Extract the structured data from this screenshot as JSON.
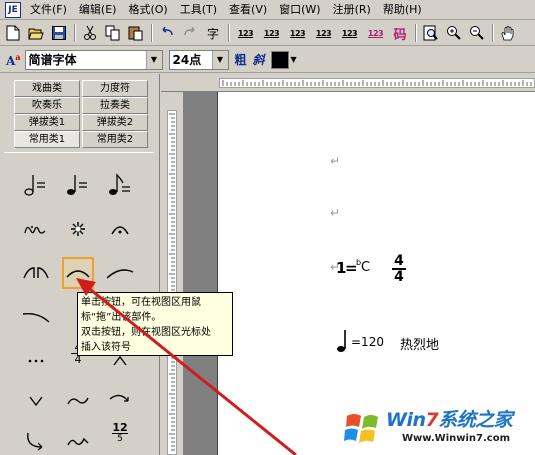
{
  "app": {
    "logo_text": "JE"
  },
  "menu": [
    "文件(F)",
    "编辑(E)",
    "格式(O)",
    "工具(T)",
    "查看(V)",
    "窗口(W)",
    "注册(R)",
    "帮助(H)"
  ],
  "toolbar": {
    "char_button": "字",
    "num_buttons": [
      "123",
      "123",
      "123",
      "123",
      "123",
      "123"
    ],
    "code_button": "码"
  },
  "format": {
    "font_name": "简谱字体",
    "font_size": "24点",
    "bold_label": "粗",
    "italic_label": "斜",
    "text_color": "#000000"
  },
  "tabs": {
    "row1": [
      "戏曲类",
      "力度符"
    ],
    "row2": [
      "吹奏乐",
      "拉奏类"
    ],
    "row3": [
      "弹拔类1",
      "弹拔类2"
    ],
    "row4": [
      "常用类1",
      "常用类2"
    ]
  },
  "palette": {
    "fraction_numerator": "4",
    "fraction_denominator": "4",
    "numeral_label": "12",
    "numeral_small": "5"
  },
  "tooltip": {
    "lines": [
      "单击按钮，可在视图区用鼠",
      "标“拖”出该部件。",
      "双击按钮，则在视图区光标处",
      "插入该符号"
    ]
  },
  "document": {
    "para_mark": "↵",
    "key_one": "1",
    "key_eq": "=",
    "key_flat": "b",
    "key_note": "C",
    "time_numerator": "4",
    "time_denominator": "4",
    "tempo_eq": "=120",
    "tempo_text": "热烈地"
  },
  "watermark": {
    "title_prefix": "Win",
    "title_number": "7",
    "title_suffix": "系统之家",
    "url": "Www.Winwin7.com"
  },
  "colors": {
    "accent_arrow": "#d01c1c",
    "highlight": "#f0a030",
    "brand_blue": "#1e73c8"
  }
}
